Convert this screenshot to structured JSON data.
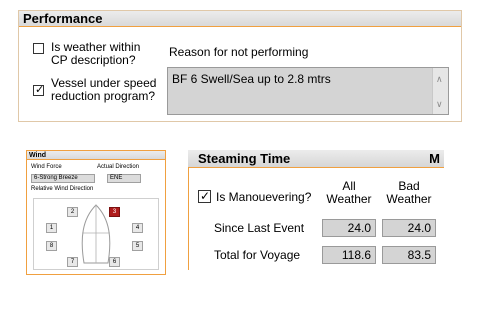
{
  "performance": {
    "title": "Performance",
    "weather_within_cp": {
      "label_line1": "Is weather within",
      "label_line2": "CP description?",
      "checked": false
    },
    "speed_reduction": {
      "label_line1": "Vessel under speed",
      "label_line2": "reduction program?",
      "checked": true
    },
    "reason_label": "Reason for not performing",
    "reason_value": "BF 6 Swell/Sea up to 2.8 mtrs"
  },
  "wind": {
    "title": "Wind",
    "force_label": "Wind Force",
    "actual_direction_label": "Actual Direction",
    "force_value": "6-Strong Breeze",
    "direction_value": "ENE",
    "relative_label": "Relative Wind Direction",
    "direction_buttons": [
      "1",
      "2",
      "3",
      "4",
      "5",
      "6",
      "7",
      "8"
    ],
    "selected_direction": "3",
    "colors": {
      "selected": "#b01c1c"
    }
  },
  "steaming": {
    "title": "Steaming Time",
    "title_suffix": "M",
    "manoeuvering": {
      "label": "Is Manouevering?",
      "checked": true
    },
    "col_all_line1": "All",
    "col_all_line2": "Weather",
    "col_bad_line1": "Bad",
    "col_bad_line2": "Weather",
    "rows": [
      {
        "label": "Since Last Event",
        "all": "24.0",
        "bad": "24.0"
      },
      {
        "label": "Total for Voyage",
        "all": "118.6",
        "bad": "83.5"
      }
    ]
  },
  "colors": {
    "accent_border": "#f0a040",
    "field_bg": "#d4d4d4"
  }
}
